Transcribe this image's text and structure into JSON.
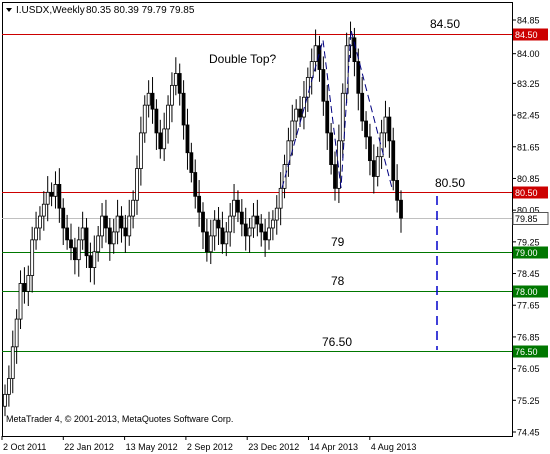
{
  "header": {
    "symbol_line": "I.USDX,Weekly",
    "ohlc": "80.35 80.39 79.79 79.85"
  },
  "colors": {
    "background": "#ffffff",
    "axis": "#000000",
    "candle": "#000000",
    "resistance": "#cc0000",
    "support": "#007700",
    "price_marker": "#555555",
    "pattern": "#000080",
    "projection": "#0000cc"
  },
  "annotations": {
    "double_top": "Double Top?",
    "label_84_50": "84.50",
    "label_80_50": "80.50",
    "label_79": "79",
    "label_78": "78",
    "label_76_50": "76.50"
  },
  "footer": {
    "copyright": "MetaTrader 4, © 2001-2013, MetaQuotes Software Corp."
  },
  "chart_data": {
    "type": "candlestick",
    "timeframe": "Weekly",
    "xaxis_labels": [
      "2 Oct 2011",
      "22 Jan 2012",
      "13 May 2012",
      "2 Sep 2012",
      "23 Dec 2012",
      "14 Apr 2013",
      "4 Aug 2013"
    ],
    "yaxis_labels": [
      "84.85",
      "84.00",
      "83.25",
      "82.45",
      "81.65",
      "80.85",
      "80.05",
      "79.25",
      "78.45",
      "77.65",
      "76.85",
      "76.05",
      "75.25",
      "74.45"
    ],
    "ylim": [
      74.45,
      84.85
    ],
    "levels": [
      {
        "value": 84.5,
        "tag": "84.50",
        "kind": "resistance"
      },
      {
        "value": 80.5,
        "tag": "80.50",
        "kind": "resistance"
      },
      {
        "value": 79.0,
        "tag": "79.00",
        "kind": "support"
      },
      {
        "value": 78.0,
        "tag": "78.00",
        "kind": "support"
      },
      {
        "value": 76.5,
        "tag": "76.50",
        "kind": "support"
      }
    ],
    "current_price": {
      "value": 79.85,
      "tag": "79.85"
    },
    "closes": [
      75.4,
      75.8,
      76.6,
      77.3,
      78.2,
      78.0,
      78.4,
      79.3,
      79.6,
      79.9,
      80.2,
      80.5,
      80.4,
      80.7,
      80.1,
      79.6,
      79.3,
      79.1,
      78.8,
      79.3,
      79.6,
      78.9,
      78.6,
      79.0,
      79.4,
      79.9,
      79.6,
      79.2,
      79.5,
      79.9,
      79.6,
      79.4,
      79.9,
      80.3,
      81.1,
      82.0,
      82.7,
      83.0,
      82.6,
      82.0,
      81.6,
      82.1,
      82.7,
      83.2,
      83.5,
      83.0,
      82.2,
      81.5,
      81.0,
      80.4,
      80.0,
      79.5,
      79.0,
      79.4,
      79.8,
      79.6,
      79.2,
      79.5,
      79.9,
      80.3,
      80.0,
      79.7,
      79.4,
      79.6,
      79.9,
      79.7,
      79.5,
      79.3,
      79.6,
      79.8,
      80.1,
      80.6,
      81.2,
      81.8,
      82.3,
      82.6,
      82.4,
      82.9,
      83.4,
      83.8,
      84.2,
      83.6,
      82.8,
      82.0,
      81.2,
      80.6,
      81.8,
      83.0,
      84.2,
      84.4,
      83.8,
      83.0,
      82.3,
      81.9,
      81.3,
      80.9,
      81.4,
      82.0,
      82.4,
      81.8,
      80.8,
      80.3,
      79.85
    ]
  }
}
